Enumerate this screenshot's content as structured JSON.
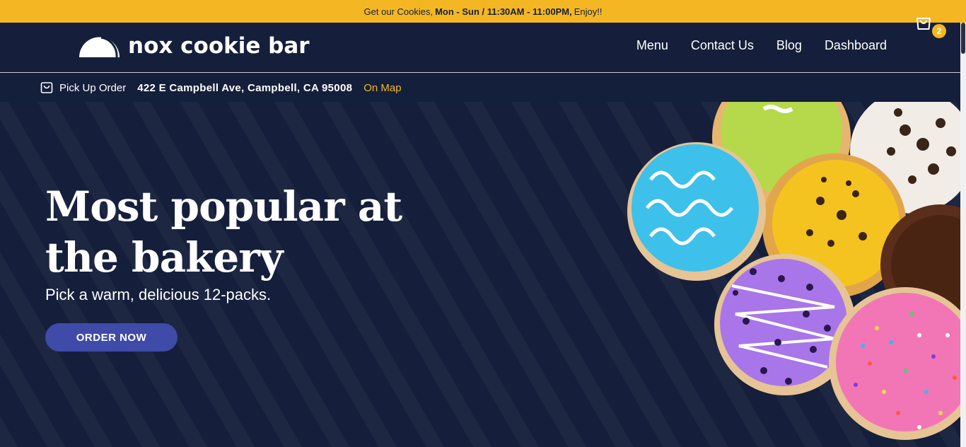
{
  "announcement": {
    "prefix": "Get our Cookies,",
    "hours": "Mon - Sun / 11:30AM - 11:00PM,",
    "suffix": "Enjoy!!"
  },
  "brand": {
    "name": "nox cookie bar"
  },
  "nav": {
    "items": [
      {
        "label": "Menu"
      },
      {
        "label": "Contact Us"
      },
      {
        "label": "Blog"
      },
      {
        "label": "Dashboard"
      }
    ]
  },
  "cart": {
    "count": "2"
  },
  "pickup": {
    "label": "Pick Up Order",
    "address": "422 E Campbell Ave, Campbell, CA 95008",
    "map_link": "On Map"
  },
  "hero": {
    "title_line1": "Most popular at",
    "title_line2": "the bakery",
    "subtitle": "Pick a warm, delicious 12-packs.",
    "cta": "ORDER NOW"
  },
  "colors": {
    "navy": "#151f3b",
    "accent": "#f4b723",
    "button": "#3e4ba8"
  },
  "icons": [
    "logo-mark-icon",
    "shopping-bag-icon",
    "pickup-bag-icon"
  ]
}
